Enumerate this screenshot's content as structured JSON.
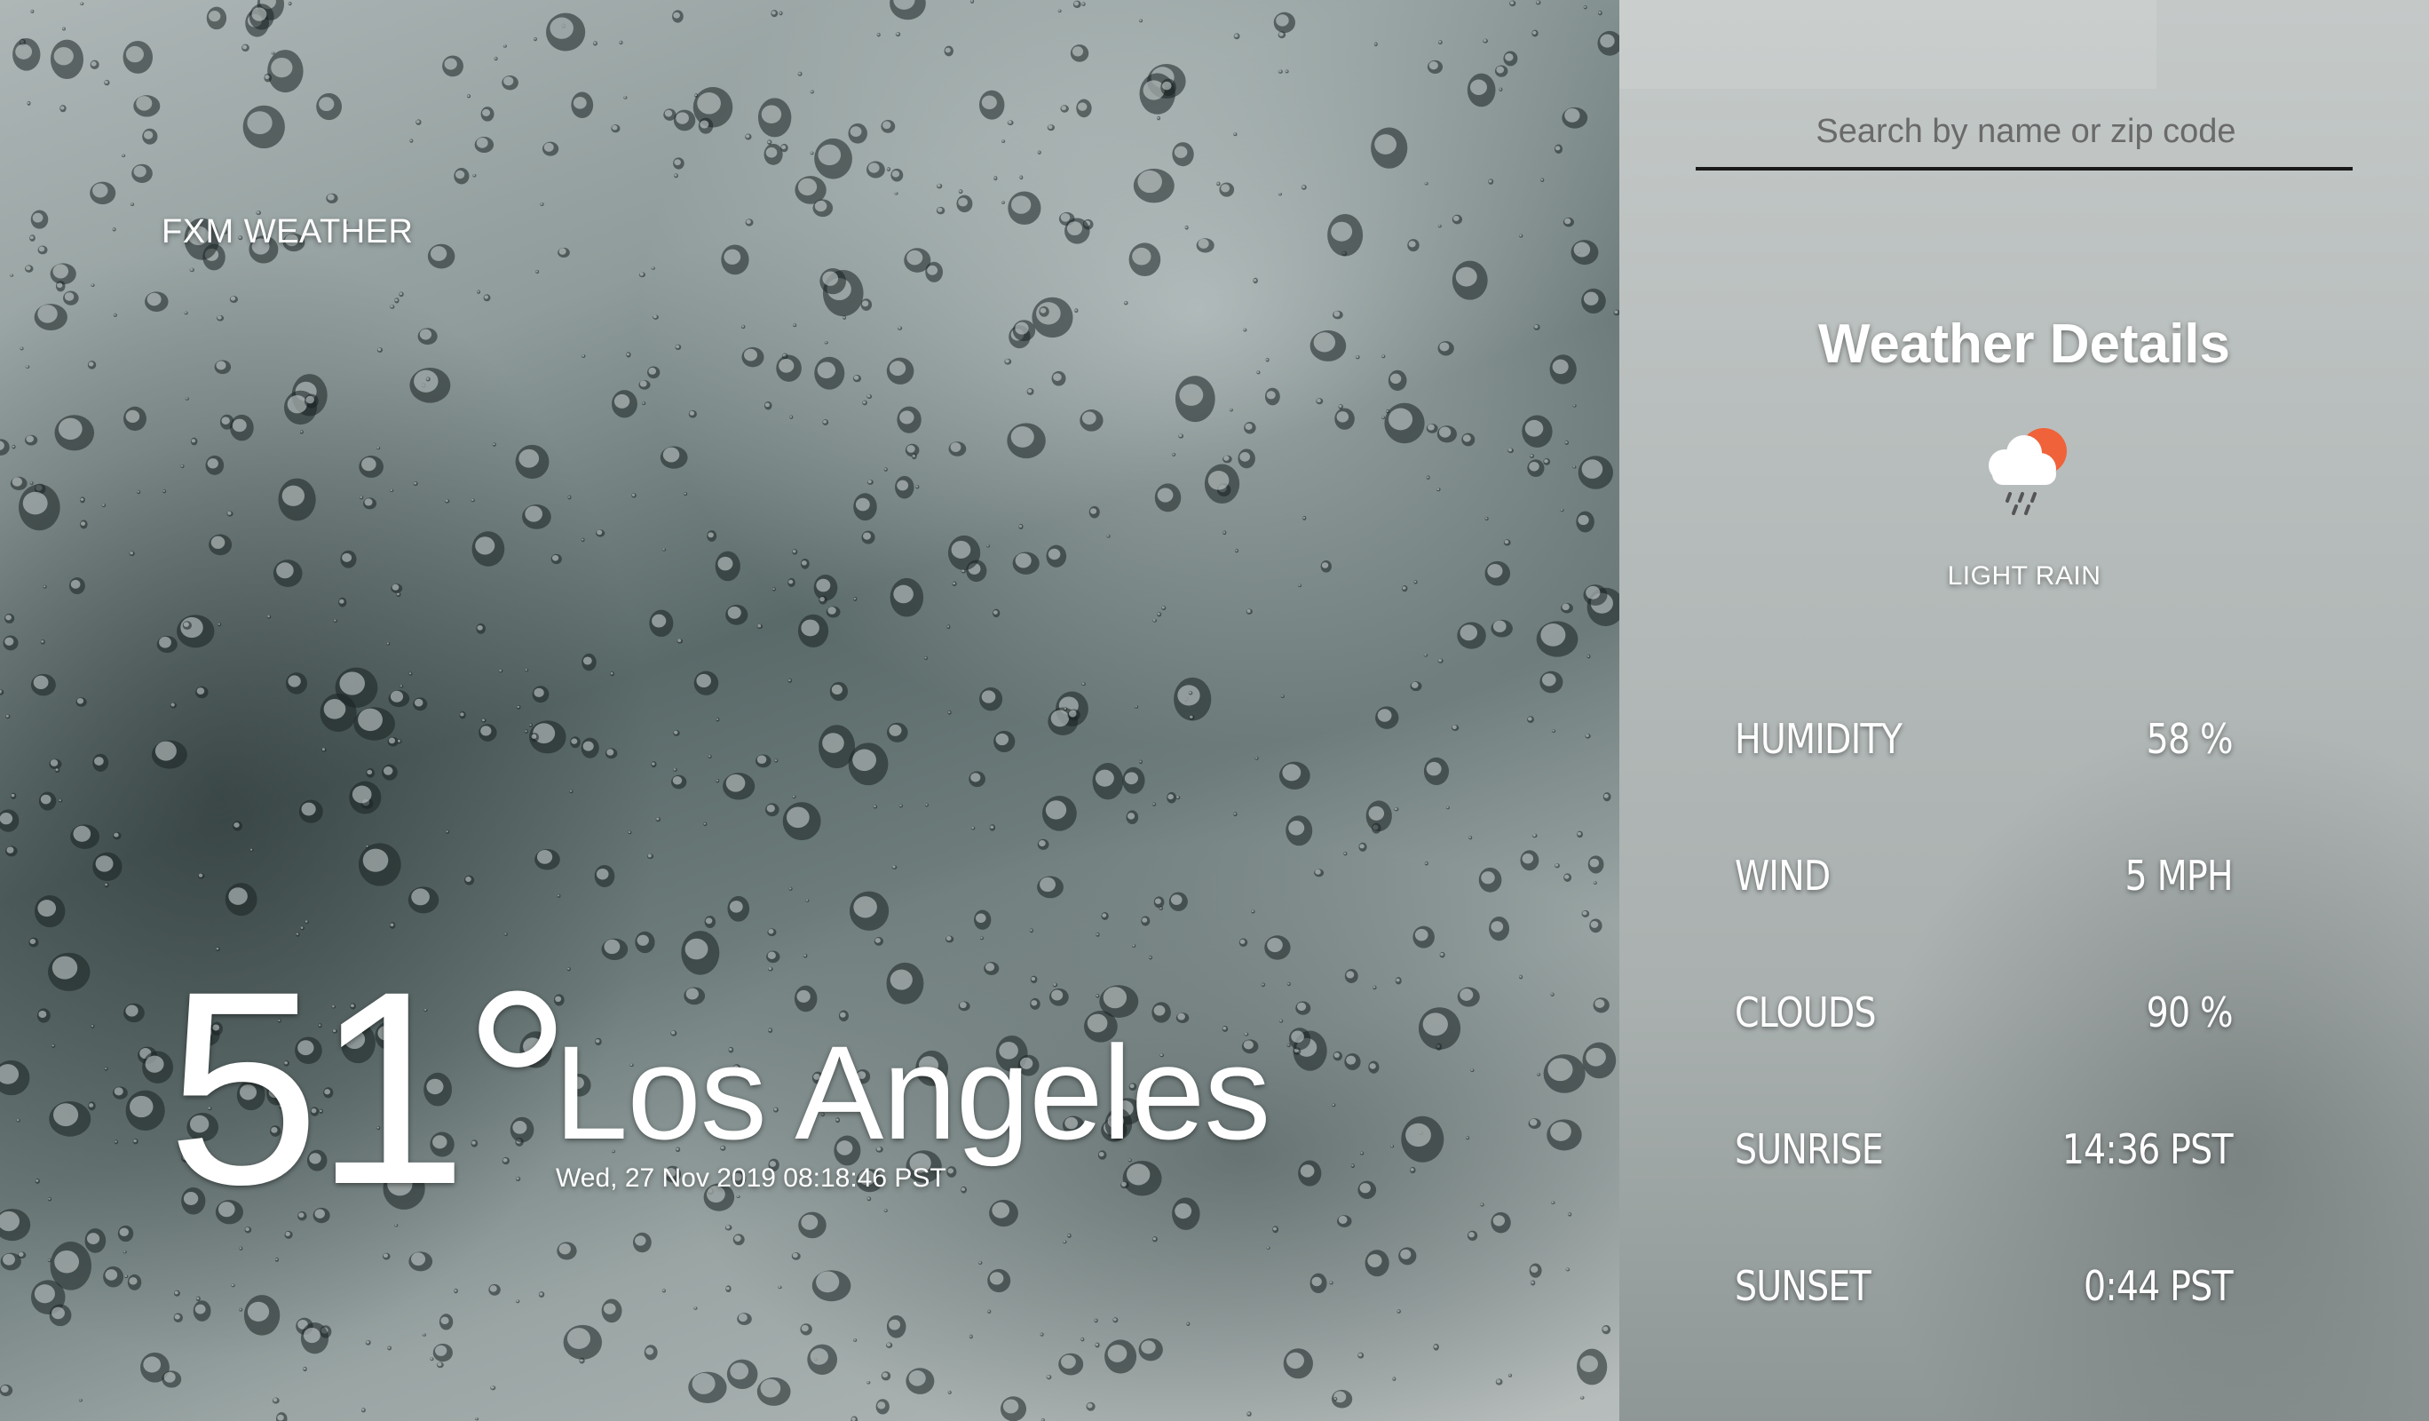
{
  "brand": "FXM WEATHER",
  "current": {
    "temperature": "51°",
    "city": "Los Angeles",
    "datetime": "Wed, 27 Nov 2019 08:18:46 PST"
  },
  "search": {
    "placeholder": "Search by name or zip code"
  },
  "details": {
    "title": "Weather Details",
    "condition_icon": "cloud-rain-sun-icon",
    "condition": "LIGHT RAIN",
    "rows": [
      {
        "label": "HUMIDITY",
        "value": "58 %"
      },
      {
        "label": "WIND",
        "value": "5 MPH"
      },
      {
        "label": "CLOUDS",
        "value": "90 %"
      },
      {
        "label": "SUNRISE",
        "value": "14:36 PST"
      },
      {
        "label": "SUNSET",
        "value": "0:44 PST"
      }
    ]
  },
  "colors": {
    "sun": "#f0623a",
    "cloud": "#ffffff",
    "search_underline": "#1a1a1a"
  }
}
